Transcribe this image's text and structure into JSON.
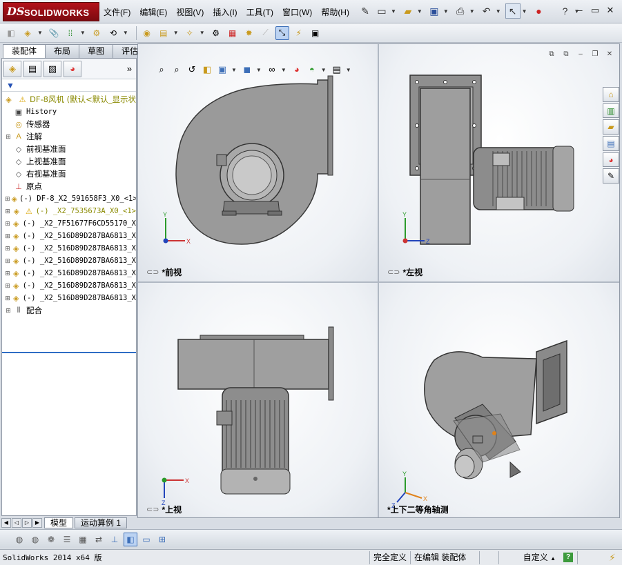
{
  "app": {
    "logo_ds": "DS",
    "logo_text": "SOLIDWORKS"
  },
  "menu": [
    "文件(F)",
    "编辑(E)",
    "视图(V)",
    "插入(I)",
    "工具(T)",
    "窗口(W)",
    "帮助(H)"
  ],
  "command_tabs": [
    "装配体",
    "布局",
    "草图",
    "评估"
  ],
  "tree": {
    "root": "DF-8风机  (默认<默认_显示状",
    "items": [
      {
        "label": "History",
        "icon": "history-icon",
        "cjk": false,
        "warn": false
      },
      {
        "label": "传感器",
        "icon": "sensor-icon",
        "cjk": true,
        "warn": false
      },
      {
        "label": "注解",
        "icon": "annotation-icon",
        "cjk": true,
        "warn": false
      },
      {
        "label": "前视基准面",
        "icon": "plane-icon",
        "cjk": true,
        "warn": false
      },
      {
        "label": "上视基准面",
        "icon": "plane-icon",
        "cjk": true,
        "warn": false
      },
      {
        "label": "右视基准面",
        "icon": "plane-icon",
        "cjk": true,
        "warn": false
      },
      {
        "label": "原点",
        "icon": "origin-icon",
        "cjk": true,
        "warn": false
      },
      {
        "label": "(-) DF-8_X2_591658F3_X0_<1>",
        "icon": "part-icon",
        "cjk": false,
        "warn": false
      },
      {
        "label": "(-) _X2_7535673A_X0_<1>",
        "icon": "part-icon",
        "cjk": false,
        "warn": true
      },
      {
        "label": "(-) _X2_7F51677F6CD55170_X",
        "icon": "part-icon",
        "cjk": false,
        "warn": false
      },
      {
        "label": "(-) _X2_516D89D287BA6813_X",
        "icon": "part-icon",
        "cjk": false,
        "warn": false
      },
      {
        "label": "(-) _X2_516D89D287BA6813_X",
        "icon": "part-icon",
        "cjk": false,
        "warn": false
      },
      {
        "label": "(-) _X2_516D89D287BA6813_X",
        "icon": "part-icon",
        "cjk": false,
        "warn": false
      },
      {
        "label": "(-) _X2_516D89D287BA6813_X",
        "icon": "part-icon",
        "cjk": false,
        "warn": false
      },
      {
        "label": "(-) _X2_516D89D287BA6813_X",
        "icon": "part-icon",
        "cjk": false,
        "warn": false
      },
      {
        "label": "(-) _X2_516D89D287BA6813_X",
        "icon": "part-icon",
        "cjk": false,
        "warn": false
      },
      {
        "label": "配合",
        "icon": "mates-icon",
        "cjk": true,
        "warn": false
      }
    ]
  },
  "bottom_tabs": [
    "模型",
    "运动算例 1"
  ],
  "views": {
    "front": "*前视",
    "left": "*左视",
    "top": "*上视",
    "iso": "*上下二等角轴测"
  },
  "axes": {
    "x": "X",
    "y": "Y",
    "z": "Z"
  },
  "status": {
    "left": "SolidWorks 2014 x64 版",
    "state": "完全定义",
    "mode": "在编辑 装配体",
    "units": "自定义",
    "help": "?"
  },
  "colors": {
    "model": "#9a9a9a",
    "model_dark": "#6f6f6f",
    "accent": "#2e6cc4"
  }
}
